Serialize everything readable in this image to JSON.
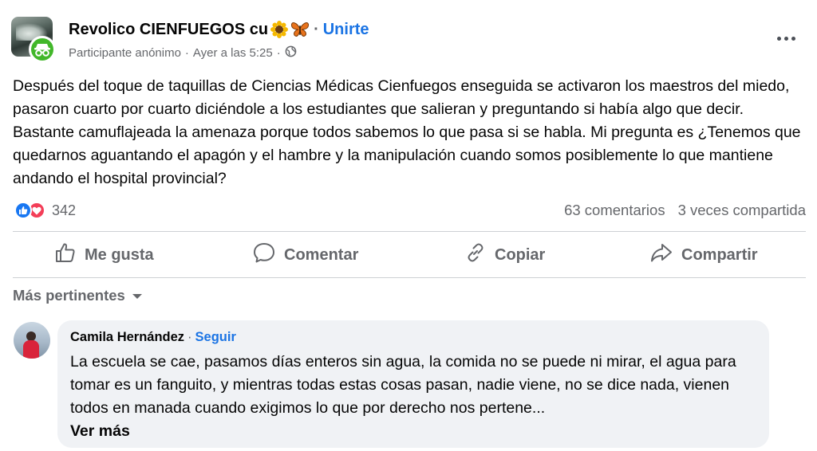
{
  "post": {
    "group_name": "Revolico CIENFUEGOS cu",
    "join_label": "Unirte",
    "author": "Participante anónimo",
    "timestamp": "Ayer a las 5:25",
    "audience_icon": "globe-icon",
    "text": "Después del toque de taquillas de Ciencias Médicas Cienfuegos enseguida se activaron los maestros del miedo, pasaron cuarto por cuarto diciéndole a los estudiantes que salieran y preguntando si había algo que decir. Bastante camuflajeada la amenaza porque todos sabemos lo que pasa si se habla. Mi pregunta es ¿Tenemos que quedarnos aguantando el apagón y el hambre y la manipulación cuando somos posiblemente lo que mantiene andando el hospital provincial?",
    "reaction_count": "342",
    "comments_count": "63 comentarios",
    "shares_count": "3 veces compartida"
  },
  "actions": {
    "like": "Me gusta",
    "comment": "Comentar",
    "copy": "Copiar",
    "share": "Compartir"
  },
  "comments": {
    "sort_label": "Más pertinentes",
    "items": [
      {
        "author": "Camila Hernández",
        "follow_label": "Seguir",
        "text": "La escuela se cae, pasamos días enteros sin agua, la comida no se puede ni mirar, el agua para tomar es un fanguito, y mientras todas estas cosas pasan, nadie viene, no se dice nada, vienen todos en manada cuando exigimos lo que por derecho nos pertene...",
        "see_more": "Ver más"
      }
    ]
  },
  "colors": {
    "accent": "#1b74e4",
    "secondary_text": "#65676b",
    "like": "#1877f2",
    "love": "#f33e58",
    "anon_badge": "#42b72a",
    "comment_bubble": "#f0f2f5"
  }
}
